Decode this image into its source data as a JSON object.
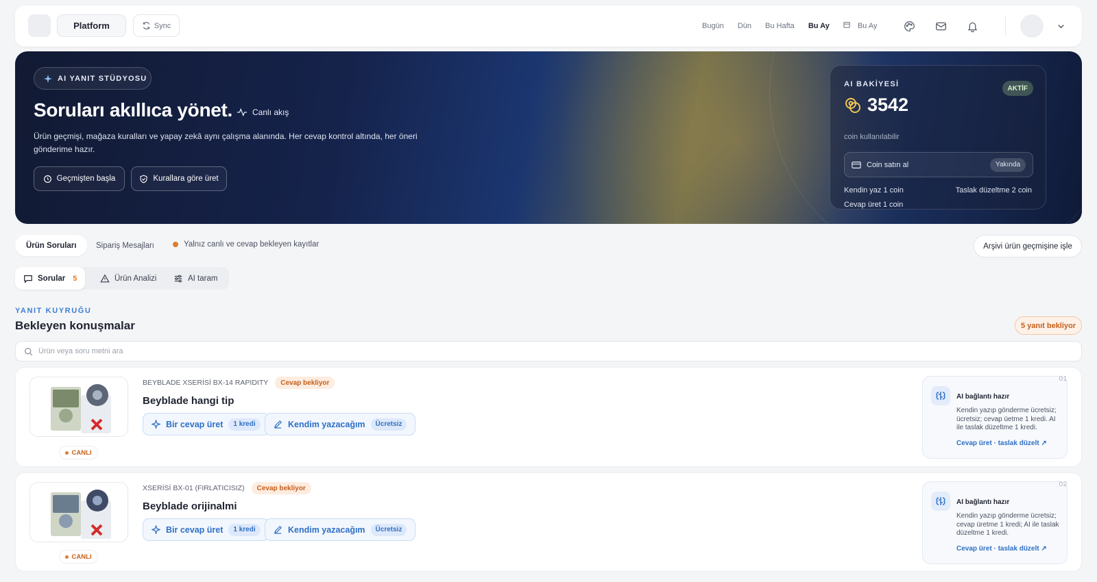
{
  "topbar": {
    "platform_label": "Platform",
    "sync_label": "Sync",
    "periods": [
      "Bugün",
      "Dün",
      "Bu Hafta",
      "Bu Ay",
      "Bu Ay"
    ],
    "active_period": "Bu Ay"
  },
  "hero": {
    "studio_label": "AI YANIT STÜDYOSU",
    "title": "Soruları akıllıca yönet.",
    "live_flow": "Canlı akış",
    "description": "Ürün geçmişi, mağaza kuralları ve yapay zekâ aynı çalışma alanında. Her cevap kontrol altında, her öneri gönderime hazır.",
    "btn_history": "Geçmişten başla",
    "btn_rules": "Kurallara göre üret"
  },
  "balance": {
    "label": "AI BAKİYESİ",
    "status": "AKTİF",
    "amount": "3542",
    "sub": "coin kullanılabilir",
    "buy_label": "Coin satın al",
    "buy_badge": "Yakında",
    "price_write": "Kendin yaz 1 coin",
    "price_edit": "Taslak düzeltme 2 coin",
    "price_generate": "Cevap üret 1 coin"
  },
  "tabs": {
    "product_questions": "Ürün Soruları",
    "order_messages": "Sipariş Mesajları",
    "live_filter": "Yalnız canlı ve cevap bekleyen kayıtlar",
    "archive_button": "Arşivi ürün geçmişine işle"
  },
  "subtabs": {
    "questions": "Sorular",
    "questions_count": "5",
    "analysis": "Ürün Analizi",
    "ai_scan": "AI taram"
  },
  "queue": {
    "kicker": "YANIT KUYRUĞU",
    "title": "Bekleyen konuşmalar",
    "waiting_badge": "5 yanıt bekliyor",
    "search_placeholder": "Ürün veya soru metni ara"
  },
  "questions": [
    {
      "product": "BEYBLADE XSERİSİ BX-14 RAPIDITY",
      "status": "Cevap bekliyor",
      "title": "Beyblade hangi tip",
      "live": "CANLI",
      "generate_label": "Bir cevap üret",
      "generate_cost": "1 kredi",
      "write_label": "Kendim yazacağım",
      "write_cost": "Ücretsiz",
      "ai_head": "AI bağlantı hazır",
      "ai_text": "Kendin yazıp gönderme ücretsiz; ücretsiz; cevap üetme 1 kredi. AI ile taslak düzeltme 1 kredi.",
      "ai_link": "Cevap üret · taslak düzelt ↗",
      "index": "01"
    },
    {
      "product": "XSERİSİ BX-01 (FIRLATICISIZ)",
      "status": "Cevap bekliyor",
      "title": "Beyblade orijinalmi",
      "live": "CANLI",
      "generate_label": "Bir cevap üret",
      "generate_cost": "1 kredi",
      "write_label": "Kendim yazacağım",
      "write_cost": "Ücretsiz",
      "ai_head": "AI bağlantı hazır",
      "ai_text": "Kendin yazıp gönderme ücretsiz; cevap üretme 1 kredi; AI ile taslak düzeltme 1 kredi.",
      "ai_link": "Cevap üret · taslak düzelt ↗",
      "index": "02"
    }
  ],
  "colors": {
    "accent_blue": "#2f6fc4",
    "accent_orange": "#e07c2c",
    "hero_dark": "#15224a"
  }
}
